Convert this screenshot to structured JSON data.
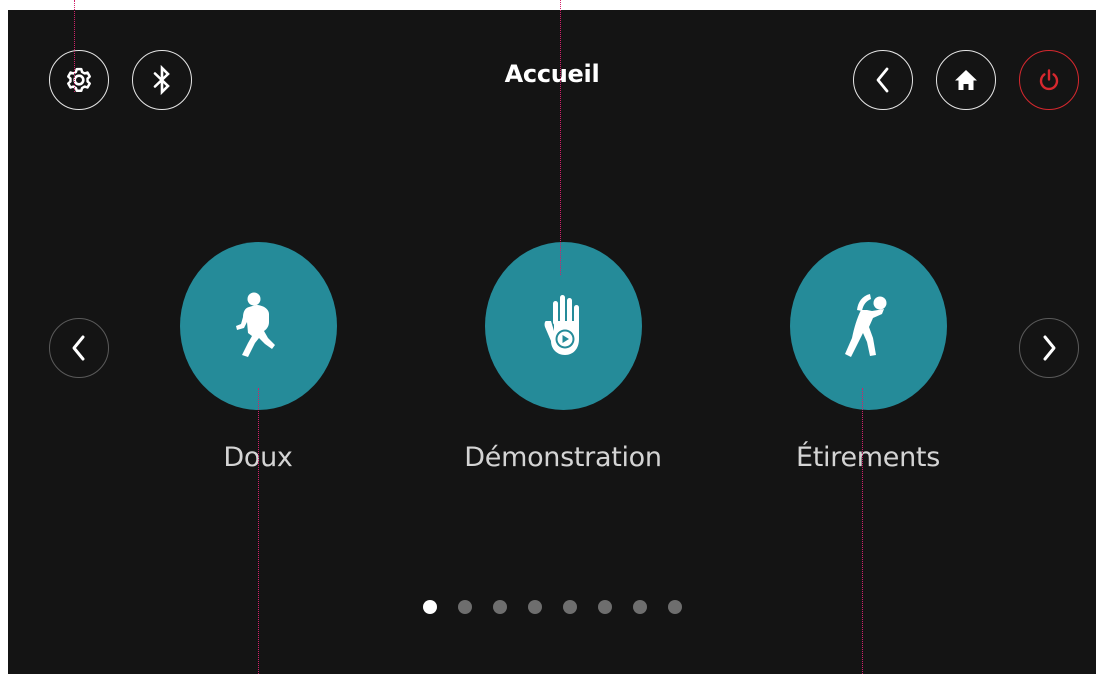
{
  "header": {
    "title": "Accueil",
    "left_icons": [
      "gear-icon",
      "bluetooth-icon"
    ],
    "right_icons": [
      "chevron-left-icon",
      "home-icon",
      "power-icon"
    ]
  },
  "carousel": {
    "prev_icon": "chevron-left-icon",
    "next_icon": "chevron-right-icon",
    "items": [
      {
        "label": "Doux",
        "icon": "gentle-walk-icon"
      },
      {
        "label": "Démonstration",
        "icon": "hand-play-icon"
      },
      {
        "label": "Étirements",
        "icon": "stretching-icon"
      }
    ]
  },
  "pagination": {
    "total_pages": 8,
    "current_page": 1
  },
  "colors": {
    "background": "#141414",
    "accent": "#258b99",
    "power": "#d6282e",
    "text": "#ffffff",
    "label": "#d4d4d4",
    "dot_inactive": "#6e6e6e",
    "guide": "#d0226a"
  }
}
